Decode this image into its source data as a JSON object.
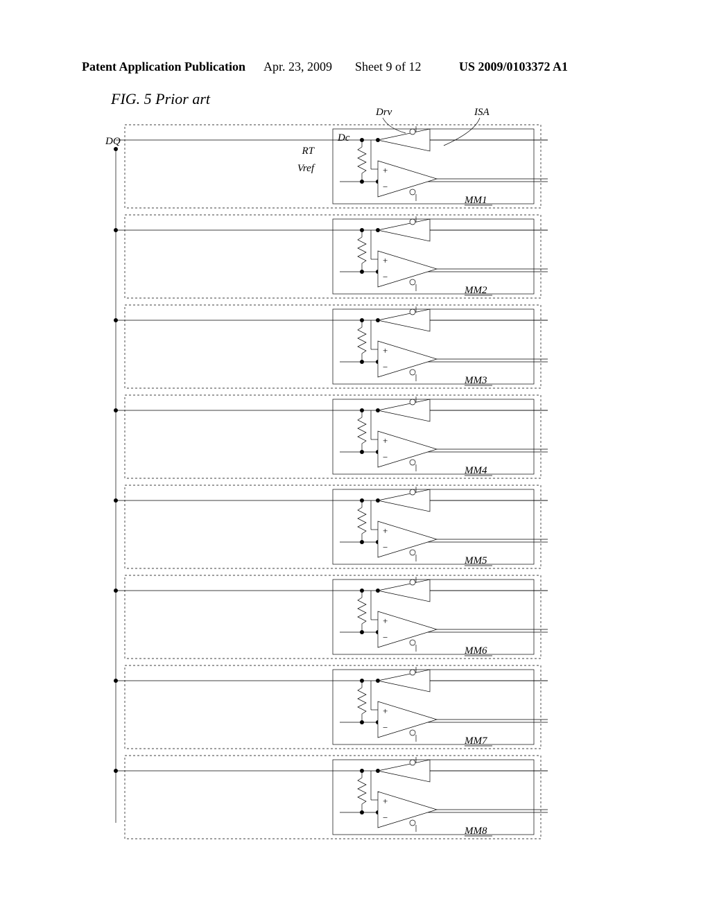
{
  "header": {
    "publication": "Patent Application Publication",
    "date": "Apr. 23, 2009",
    "sheet": "Sheet 9 of 12",
    "number": "US 2009/0103372 A1"
  },
  "figure": {
    "label": "FIG. 5 Prior art",
    "globals": {
      "dq": "DQ",
      "drv": "Drv",
      "isa": "ISA",
      "dc": "Dc",
      "rt": "RT",
      "vref": "Vref"
    },
    "modules": [
      {
        "id": "MM1"
      },
      {
        "id": "MM2"
      },
      {
        "id": "MM3"
      },
      {
        "id": "MM4"
      },
      {
        "id": "MM5"
      },
      {
        "id": "MM6"
      },
      {
        "id": "MM7"
      },
      {
        "id": "MM8"
      }
    ]
  }
}
